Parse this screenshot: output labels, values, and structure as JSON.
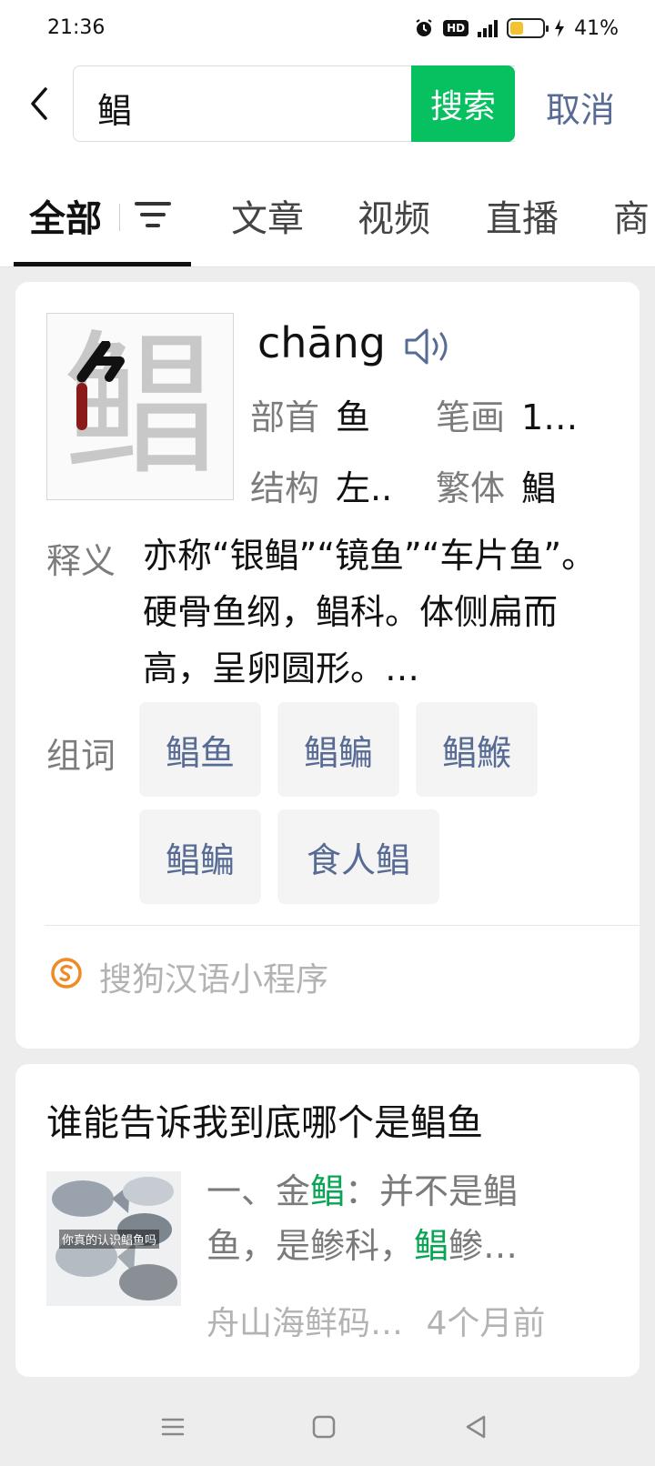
{
  "status_bar": {
    "time": "21:36",
    "hd_label": "HD",
    "battery_percent": "41%",
    "battery_level": 0.41,
    "icons": [
      "alarm-icon",
      "hd-icon",
      "signal-4g-icon",
      "battery-icon",
      "charging-icon"
    ]
  },
  "search": {
    "query": "鲳",
    "search_label": "搜索",
    "cancel_label": "取消",
    "accent": "#07c160"
  },
  "tabs": {
    "items": [
      "全部",
      "文章",
      "视频",
      "直播",
      "商"
    ],
    "active": "全部"
  },
  "dict": {
    "character": "鲳",
    "pinyin": "chāng",
    "radical_label": "部首",
    "radical_value": "鱼",
    "strokes_label": "笔画",
    "strokes_value": "1…",
    "structure_label": "结构",
    "structure_value": "左..",
    "traditional_label": "繁体",
    "traditional_value": "鯧",
    "definition_label": "释义",
    "definition_text": "亦称“银鲳”“镜鱼”“车片鱼”。硬骨鱼纲，鲳科。体侧扁而高，呈卵圆形。…",
    "words_label": "组词",
    "words": [
      "鲳鱼",
      "鲳鳊",
      "鲳鯸",
      "鲳鳊",
      "食人鲳"
    ],
    "source": "搜狗汉语小程序"
  },
  "article": {
    "title": "谁能告诉我到底哪个是鲳鱼",
    "thumb_caption": "你真的认识鲳鱼吗",
    "snippet_1": "一、金",
    "snippet_hl_1": "鲳",
    "snippet_2": "：并不是鲳鱼，是鲹科，",
    "snippet_hl_2": "鲳",
    "snippet_3": "鲹…",
    "source": "舟山海鲜码…",
    "time": "4个月前"
  },
  "nav": {
    "icons": [
      "menu-icon",
      "home-icon",
      "back-triangle-icon"
    ]
  }
}
